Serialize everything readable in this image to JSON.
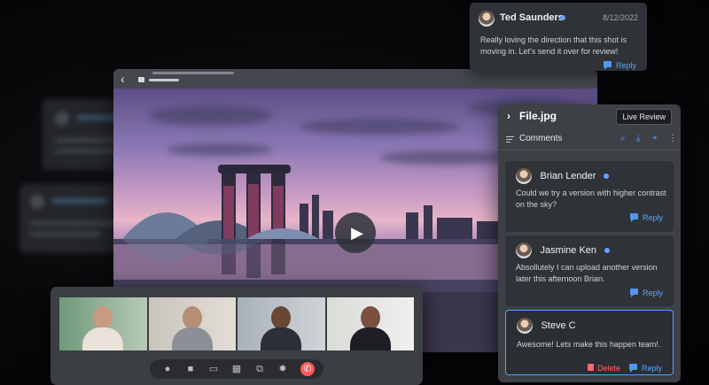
{
  "top_comment": {
    "author": "Ted Saunders",
    "date": "8/12/2022",
    "message": "Really loving the direction that this shot is moving in. Let's send it over for review!",
    "reply_label": "Reply"
  },
  "panel": {
    "file_name": "File.jpg",
    "live_review_label": "Live Review",
    "comments_label": "Comments",
    "tool_icons": [
      "search-icon",
      "download-icon",
      "add-user-icon",
      "more-icon"
    ],
    "comments": [
      {
        "author": "Brian Lender",
        "online": true,
        "message": "Could we try a version with higher contrast on the sky?",
        "reply_label": "Reply"
      },
      {
        "author": "Jasmine Ken",
        "online": true,
        "message": "Absollutely I can upload another version later this afternoon Brian.",
        "reply_label": "Reply"
      },
      {
        "author": "Steve C",
        "online": false,
        "message": "Awesome! Lets make this happen team!.",
        "delete_label": "Delete",
        "reply_label": "Reply"
      }
    ]
  },
  "viewer": {
    "icons": [
      "back-icon",
      "folder-icon"
    ],
    "play_icon": "play-icon"
  },
  "call": {
    "participants": 4,
    "controls": [
      "microphone-icon",
      "camera-icon",
      "screen-share-icon",
      "grid-icon",
      "pop-out-icon",
      "settings-icon",
      "end-call-icon"
    ]
  },
  "colors": {
    "accent": "#4aa3ff",
    "danger": "#ff5a5a",
    "panel_bg": "#3d4045",
    "card_bg": "#2f3236"
  }
}
